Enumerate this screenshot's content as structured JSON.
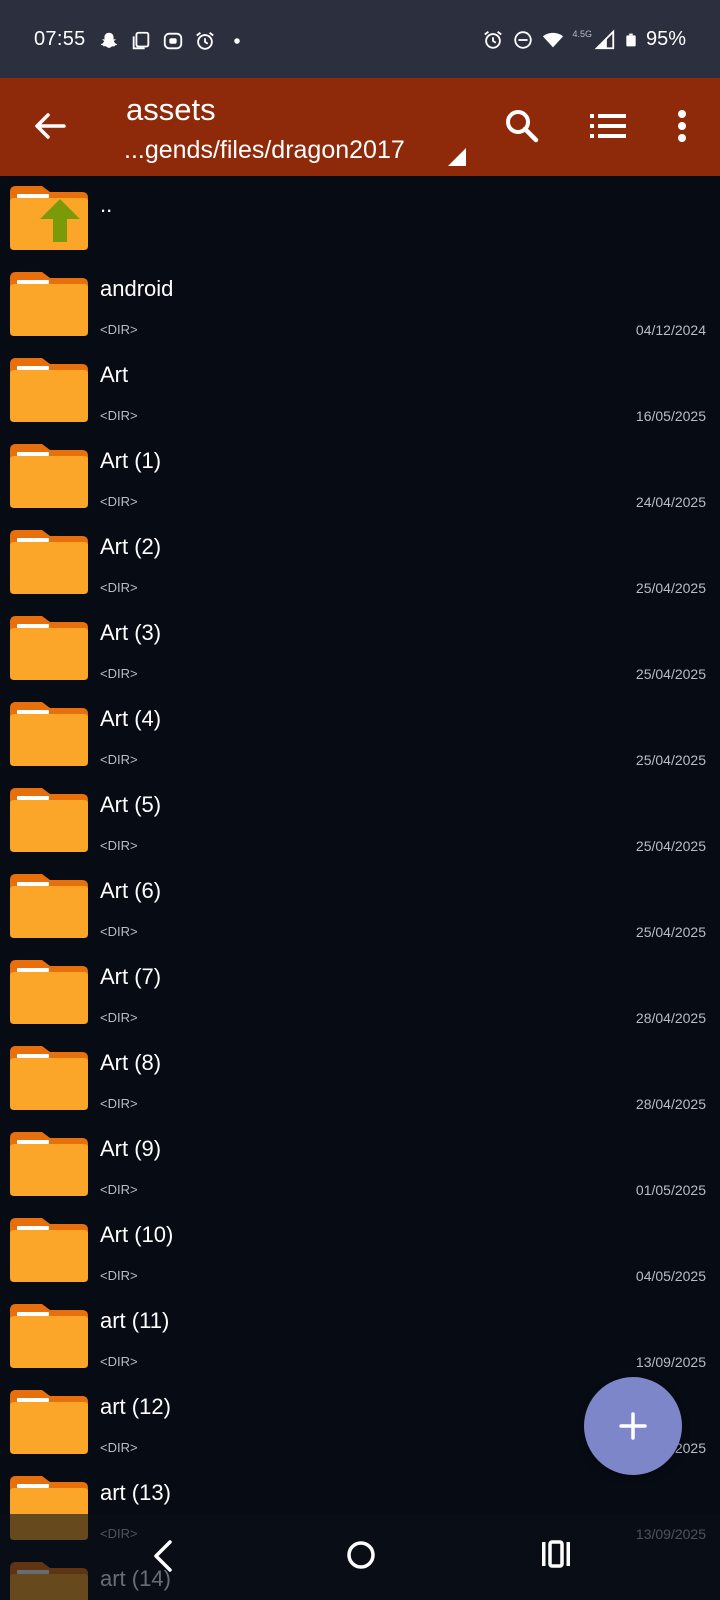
{
  "status_bar": {
    "time": "07:55",
    "left_icons": [
      "snapchat-icon",
      "copy-icon",
      "bitmoji-icon",
      "alarm-icon",
      "dot-icon"
    ],
    "right_icons": [
      "alarm-icon",
      "do-not-disturb-icon",
      "wifi-icon",
      "signal-icon",
      "battery-icon"
    ],
    "network_label": "4.5G",
    "battery": "95%"
  },
  "app_bar": {
    "title": "assets",
    "path": "...gends/files/dragon2017",
    "icons": [
      "back-arrow-icon",
      "search-icon",
      "list-view-icon",
      "more-vert-icon"
    ],
    "accent": "#8e2a0a"
  },
  "files": [
    {
      "name": "..",
      "meta": "",
      "date": "",
      "type": "parent"
    },
    {
      "name": "android",
      "meta": "<DIR>",
      "date": "04/12/2024",
      "type": "dir"
    },
    {
      "name": "Art",
      "meta": "<DIR>",
      "date": "16/05/2025",
      "type": "dir"
    },
    {
      "name": "Art (1)",
      "meta": "<DIR>",
      "date": "24/04/2025",
      "type": "dir"
    },
    {
      "name": "Art (2)",
      "meta": "<DIR>",
      "date": "25/04/2025",
      "type": "dir"
    },
    {
      "name": "Art (3)",
      "meta": "<DIR>",
      "date": "25/04/2025",
      "type": "dir"
    },
    {
      "name": "Art (4)",
      "meta": "<DIR>",
      "date": "25/04/2025",
      "type": "dir"
    },
    {
      "name": "Art (5)",
      "meta": "<DIR>",
      "date": "25/04/2025",
      "type": "dir"
    },
    {
      "name": "Art (6)",
      "meta": "<DIR>",
      "date": "25/04/2025",
      "type": "dir"
    },
    {
      "name": "Art (7)",
      "meta": "<DIR>",
      "date": "28/04/2025",
      "type": "dir"
    },
    {
      "name": "Art (8)",
      "meta": "<DIR>",
      "date": "28/04/2025",
      "type": "dir"
    },
    {
      "name": "Art (9)",
      "meta": "<DIR>",
      "date": "01/05/2025",
      "type": "dir"
    },
    {
      "name": "Art (10)",
      "meta": "<DIR>",
      "date": "04/05/2025",
      "type": "dir"
    },
    {
      "name": "art (11)",
      "meta": "<DIR>",
      "date": "13/09/2025",
      "type": "dir"
    },
    {
      "name": "art (12)",
      "meta": "<DIR>",
      "date": "13/09/2025",
      "type": "dir"
    },
    {
      "name": "art (13)",
      "meta": "<DIR>",
      "date": "13/09/2025",
      "type": "dir"
    },
    {
      "name": "art (14)",
      "meta": "",
      "date": "",
      "type": "dir"
    }
  ],
  "fab": {
    "icon": "plus-icon",
    "color": "#7c86c9"
  },
  "nav_bar": {
    "icons": [
      "nav-back-icon",
      "nav-home-icon",
      "nav-recents-icon"
    ]
  }
}
